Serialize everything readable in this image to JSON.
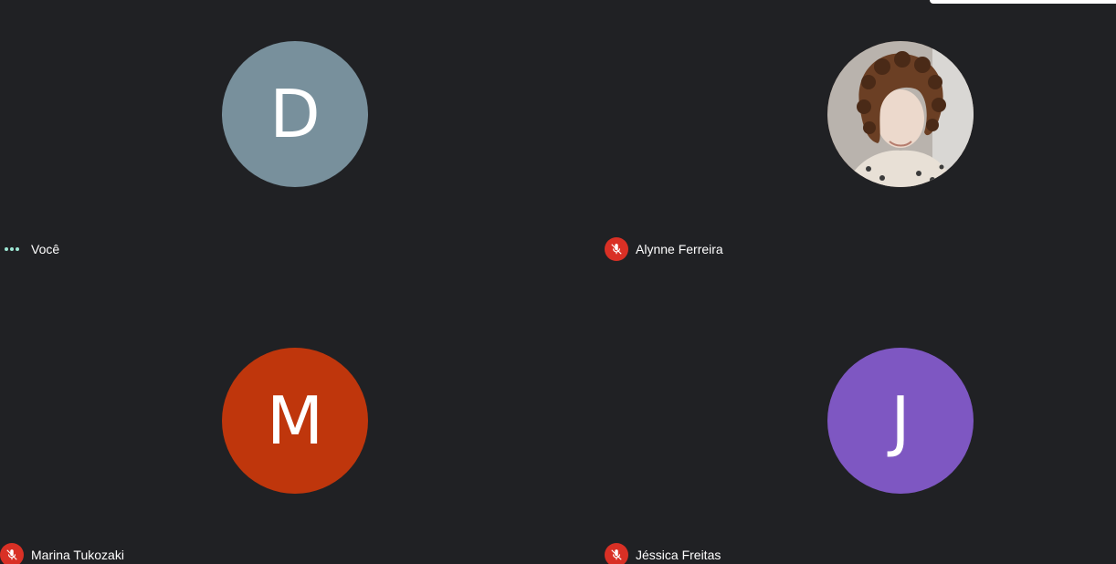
{
  "participants": [
    {
      "name": "Você",
      "initial": "D",
      "avatar_color": "#78909c",
      "status": "speaking-indicator"
    },
    {
      "name": "Alynne Ferreira",
      "initial": "",
      "avatar_color": "",
      "status": "muted",
      "photo": true
    },
    {
      "name": "Marina Tukozaki",
      "initial": "M",
      "avatar_color": "#bf360c",
      "status": "muted"
    },
    {
      "name": "Jéssica Freitas",
      "initial": "J",
      "avatar_color": "#7e57c2",
      "status": "muted"
    }
  ],
  "icons": {
    "mic_off": "mic-off-icon",
    "speaking": "audio-level-icon"
  },
  "colors": {
    "background": "#202124",
    "muted_badge": "#d93025",
    "speaking_dots": "#9ee7d4"
  }
}
